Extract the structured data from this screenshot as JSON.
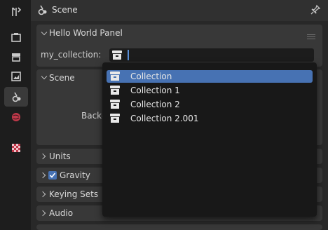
{
  "header": {
    "title": "Scene"
  },
  "hello_panel": {
    "title": "Hello World Panel",
    "prop_label": "my_collection:",
    "field_value": ""
  },
  "scene_panel": {
    "title": "Scene",
    "background_label": "Backg"
  },
  "collapsed_panels": [
    {
      "label": "Units"
    },
    {
      "label": "Gravity"
    },
    {
      "label": "Keying Sets"
    },
    {
      "label": "Audio"
    }
  ],
  "dropdown": {
    "items": [
      {
        "label": "Collection",
        "selected": true
      },
      {
        "label": "Collection 1"
      },
      {
        "label": "Collection 2"
      },
      {
        "label": "Collection 2.001"
      }
    ]
  },
  "colors": {
    "accent": "#4772b3",
    "panel": "#383838",
    "background": "#282828"
  },
  "icons": [
    "tool-icon",
    "render-icon",
    "output-icon",
    "view-layer-icon",
    "scene-icon",
    "world-icon",
    "texture-icon",
    "pin-icon",
    "collection-icon"
  ]
}
